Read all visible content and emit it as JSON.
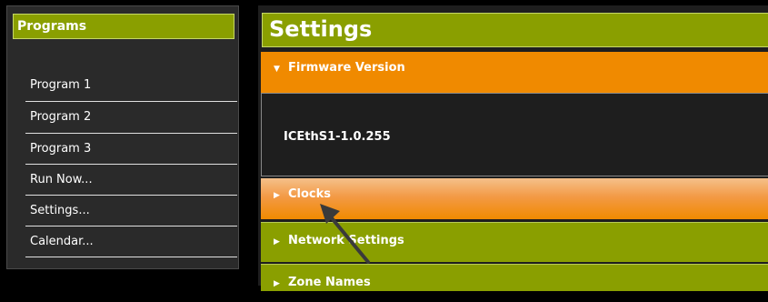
{
  "programs_panel": {
    "title": "Programs",
    "items": [
      {
        "label": "Program 1"
      },
      {
        "label": "Program 2"
      },
      {
        "label": "Program 3"
      },
      {
        "label": "Run Now..."
      },
      {
        "label": "Settings..."
      },
      {
        "label": "Calendar..."
      }
    ]
  },
  "settings_panel": {
    "title": "Settings",
    "sections": [
      {
        "label": "Firmware Version",
        "expanded": true,
        "value": "ICEthS1-1.0.255"
      },
      {
        "label": "Clocks",
        "expanded": false
      },
      {
        "label": "Network Settings",
        "expanded": false
      },
      {
        "label": "Zone Names",
        "expanded": false
      }
    ]
  },
  "icons": {
    "expanded": "triangle-down-icon",
    "collapsed": "triangle-right-icon",
    "pointer": "arrow-pointer-icon"
  },
  "colors": {
    "green_header": "#8a9f00",
    "orange_active": "#f08a00",
    "panel_bg": "#2a2a2a"
  }
}
